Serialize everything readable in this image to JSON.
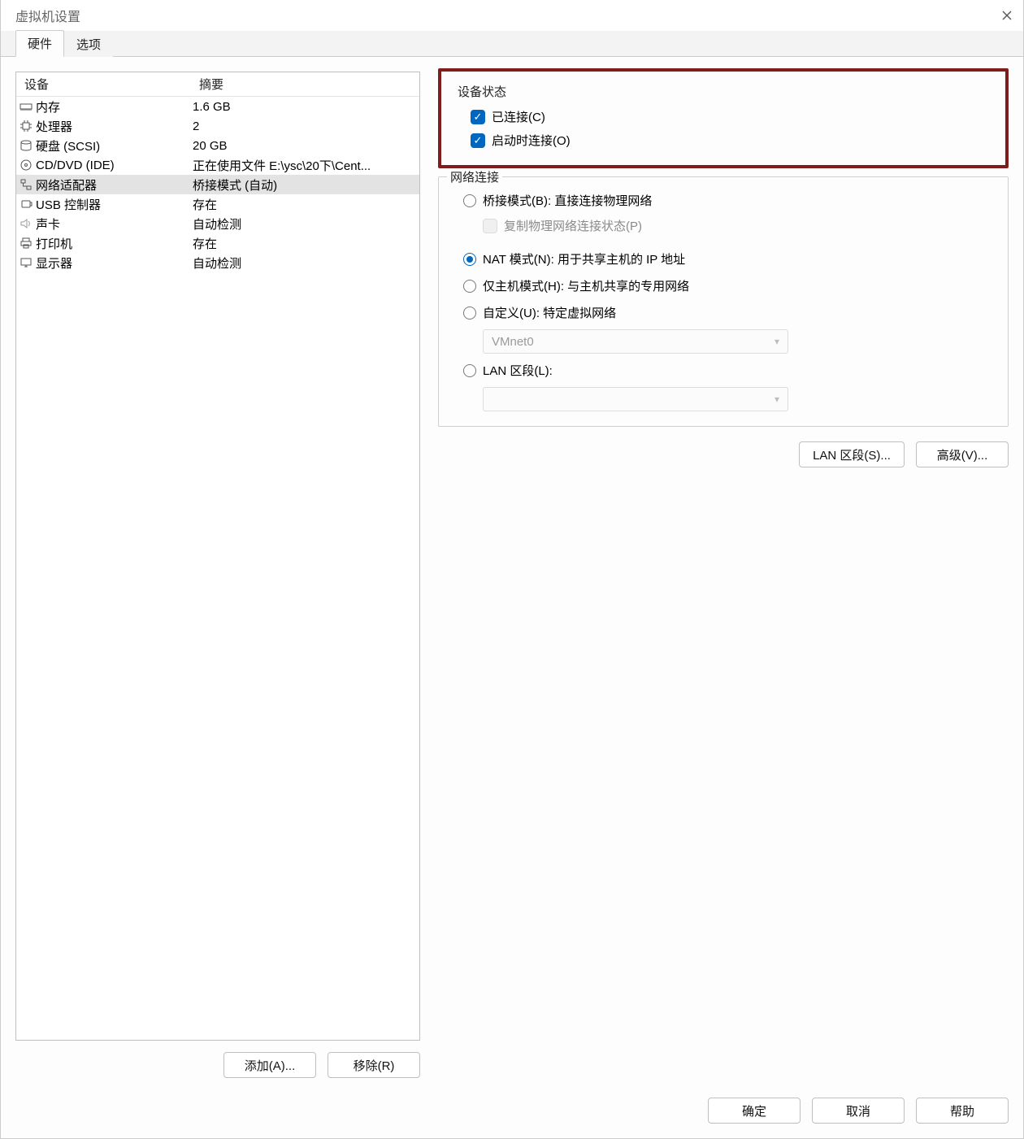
{
  "window": {
    "title": "虚拟机设置"
  },
  "tabs": {
    "hardware": "硬件",
    "options": "选项"
  },
  "deviceTable": {
    "header": {
      "device": "设备",
      "summary": "摘要"
    },
    "rows": [
      {
        "icon": "memory-icon",
        "name": "内存",
        "summary": "1.6 GB"
      },
      {
        "icon": "cpu-icon",
        "name": "处理器",
        "summary": "2"
      },
      {
        "icon": "disk-icon",
        "name": "硬盘 (SCSI)",
        "summary": "20 GB"
      },
      {
        "icon": "cd-icon",
        "name": "CD/DVD (IDE)",
        "summary": "正在使用文件 E:\\ysc\\20下\\Cent..."
      },
      {
        "icon": "network-icon",
        "name": "网络适配器",
        "summary": "桥接模式 (自动)"
      },
      {
        "icon": "usb-icon",
        "name": "USB 控制器",
        "summary": "存在"
      },
      {
        "icon": "sound-icon",
        "name": "声卡",
        "summary": "自动检测"
      },
      {
        "icon": "printer-icon",
        "name": "打印机",
        "summary": "存在"
      },
      {
        "icon": "display-icon",
        "name": "显示器",
        "summary": "自动检测"
      }
    ],
    "selectedIndex": 4
  },
  "leftButtons": {
    "add": "添加(A)...",
    "remove": "移除(R)"
  },
  "deviceStatus": {
    "legend": "设备状态",
    "connected": "已连接(C)",
    "connectAtPowerOn": "启动时连接(O)"
  },
  "networkConnection": {
    "legend": "网络连接",
    "bridged": "桥接模式(B): 直接连接物理网络",
    "replicate": "复制物理网络连接状态(P)",
    "nat": "NAT 模式(N): 用于共享主机的 IP 地址",
    "hostOnly": "仅主机模式(H): 与主机共享的专用网络",
    "custom": "自定义(U): 特定虚拟网络",
    "customValue": "VMnet0",
    "lanSegment": "LAN 区段(L):",
    "lanSegmentValue": ""
  },
  "rightButtons": {
    "lanSegments": "LAN 区段(S)...",
    "advanced": "高级(V)..."
  },
  "bottom": {
    "ok": "确定",
    "cancel": "取消",
    "help": "帮助"
  }
}
